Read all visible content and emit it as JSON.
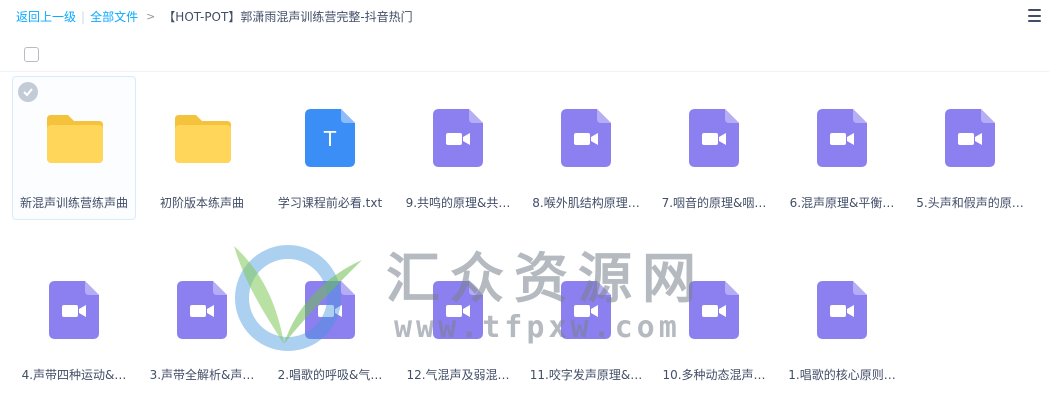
{
  "breadcrumb": {
    "back": "返回上一级",
    "all_files": "全部文件",
    "current": "【HOT-POT】郭潇雨混声训练营完整-抖音热门"
  },
  "watermark": {
    "text": "汇众资源网",
    "url": "www.tfpxw.com"
  },
  "colors": {
    "link": "#09aaff",
    "folder": "#ffd659",
    "video": "#8c7ff0",
    "doc": "#3a8ef6"
  },
  "files": [
    {
      "name": "新混声训练营练声曲",
      "type": "folder",
      "selected": true
    },
    {
      "name": "初阶版本练声曲",
      "type": "folder",
      "selected": false
    },
    {
      "name": "学习课程前必看.txt",
      "type": "txt",
      "icon_letter": "T",
      "selected": false
    },
    {
      "name": "9.共鸣的原理&共…",
      "type": "video",
      "selected": false
    },
    {
      "name": "8.喉外肌结构原理…",
      "type": "video",
      "selected": false
    },
    {
      "name": "7.咽音的原理&咽…",
      "type": "video",
      "selected": false
    },
    {
      "name": "6.混声原理&平衡…",
      "type": "video",
      "selected": false
    },
    {
      "name": "5.头声和假声的原…",
      "type": "video",
      "selected": false
    },
    {
      "name": "4.声带四种运动&…",
      "type": "video",
      "selected": false
    },
    {
      "name": "3.声带全解析&声…",
      "type": "video",
      "selected": false
    },
    {
      "name": "2.唱歌的呼吸&气…",
      "type": "video",
      "selected": false
    },
    {
      "name": "12.气混声及弱混…",
      "type": "video",
      "selected": false
    },
    {
      "name": "11.咬字发声原理&…",
      "type": "video",
      "selected": false
    },
    {
      "name": "10.多种动态混声…",
      "type": "video",
      "selected": false
    },
    {
      "name": "1.唱歌的核心原则…",
      "type": "video",
      "selected": false
    }
  ]
}
